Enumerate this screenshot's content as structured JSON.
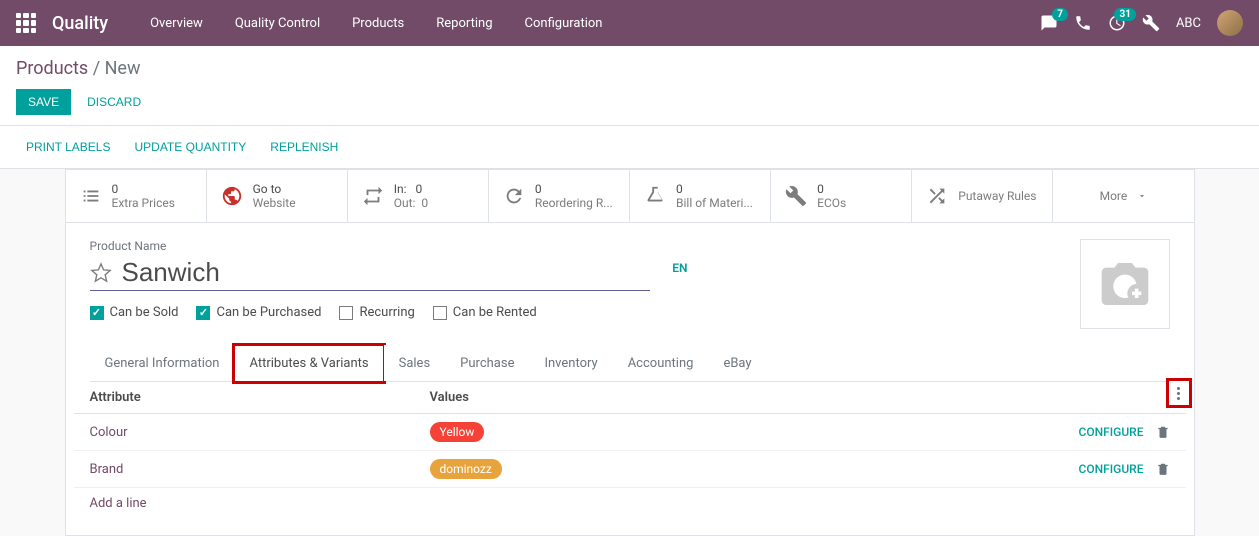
{
  "navbar": {
    "app_title": "Quality",
    "links": [
      "Overview",
      "Quality Control",
      "Products",
      "Reporting",
      "Configuration"
    ],
    "msg_count": "7",
    "activity_count": "31",
    "user": "ABC"
  },
  "breadcrumb": {
    "parent": "Products",
    "current": "New"
  },
  "buttons": {
    "save": "SAVE",
    "discard": "DISCARD"
  },
  "actions": [
    "PRINT LABELS",
    "UPDATE QUANTITY",
    "REPLENISH"
  ],
  "stats": [
    {
      "val": "0",
      "lbl": "Extra Prices",
      "icon": "list"
    },
    {
      "val": "Go to",
      "lbl": "Website",
      "icon": "globe"
    },
    {
      "val": "In:   0",
      "lbl": "Out:  0",
      "icon": "transfer"
    },
    {
      "val": "0",
      "lbl": "Reordering R...",
      "icon": "refresh"
    },
    {
      "val": "0",
      "lbl": "Bill of Materi...",
      "icon": "flask"
    },
    {
      "val": "0",
      "lbl": "ECOs",
      "icon": "wrench"
    },
    {
      "val": "",
      "lbl": "Putaway Rules",
      "icon": "shuffle"
    },
    {
      "val": "",
      "lbl": "More",
      "icon": ""
    }
  ],
  "product": {
    "name_label": "Product Name",
    "name": "Sanwich",
    "lang": "EN",
    "checks": [
      {
        "label": "Can be Sold",
        "checked": true
      },
      {
        "label": "Can be Purchased",
        "checked": true
      },
      {
        "label": "Recurring",
        "checked": false
      },
      {
        "label": "Can be Rented",
        "checked": false
      }
    ]
  },
  "tabs": [
    "General Information",
    "Attributes & Variants",
    "Sales",
    "Purchase",
    "Inventory",
    "Accounting",
    "eBay"
  ],
  "attr_table": {
    "headers": {
      "attr": "Attribute",
      "val": "Values"
    },
    "rows": [
      {
        "attr": "Colour",
        "value": "Yellow",
        "tag_class": "tag-yellow"
      },
      {
        "attr": "Brand",
        "value": "dominozz",
        "tag_class": "tag-brand"
      }
    ],
    "configure": "CONFIGURE",
    "add_line": "Add a line"
  }
}
